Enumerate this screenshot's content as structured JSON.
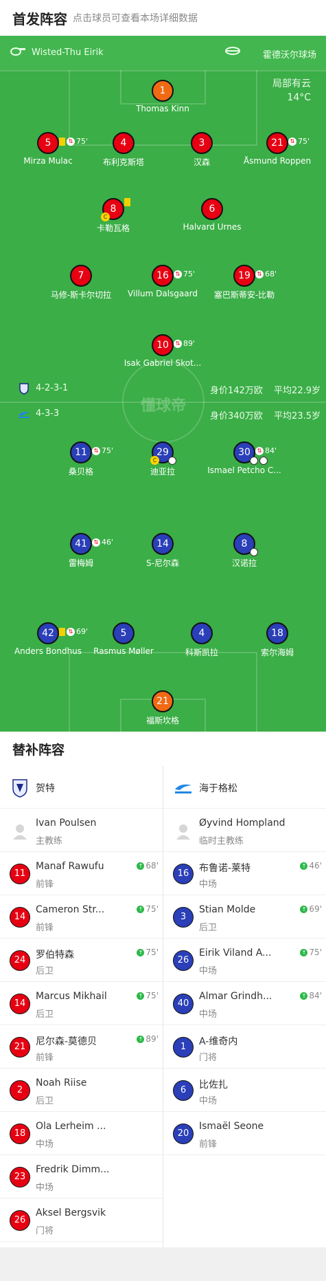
{
  "header": {
    "title": "首发阵容",
    "subtitle": "点击球员可查看本场详细数据"
  },
  "pitch": {
    "home_team": "Wisted-Thu Eirik",
    "venue": "霍德沃尔球场",
    "weather": "局部有云",
    "temperature": "14°C",
    "watermark": "懂球帝"
  },
  "home": {
    "formation": "4-2-3-1",
    "value": "身价142万欧",
    "avg_age": "平均22.9岁",
    "players": [
      {
        "num": "1",
        "name": "Thomas Kinn",
        "gk": true
      },
      {
        "num": "5",
        "name": "Mirza Mulac",
        "yellow": true,
        "sub": "75'"
      },
      {
        "num": "4",
        "name": "布利克斯塔"
      },
      {
        "num": "3",
        "name": "汉森"
      },
      {
        "num": "21",
        "name": "Åsmund Roppen",
        "sub": "75'"
      },
      {
        "num": "8",
        "name": "卡勒瓦格",
        "yellow": true,
        "captain": true
      },
      {
        "num": "6",
        "name": "Halvard Urnes"
      },
      {
        "num": "7",
        "name": "马修-斯卡尔切拉"
      },
      {
        "num": "16",
        "name": "Villum Dalsgaard",
        "sub": "75'"
      },
      {
        "num": "19",
        "name": "塞巴斯蒂安-比勒",
        "sub": "68'"
      },
      {
        "num": "10",
        "name": "Isak Gabriel Skot...",
        "sub": "89'"
      }
    ]
  },
  "away": {
    "formation": "4-3-3",
    "value": "身价340万欧",
    "avg_age": "平均23.5岁",
    "players": [
      {
        "num": "11",
        "name": "桑贝格",
        "sub": "75'"
      },
      {
        "num": "29",
        "name": "迪亚拉",
        "captain": true,
        "goal": true
      },
      {
        "num": "30",
        "name": "Ismael Petcho C...",
        "sub": "84'",
        "goals": 2
      },
      {
        "num": "41",
        "name": "雷梅姆",
        "sub": "46'"
      },
      {
        "num": "14",
        "name": "S-尼尔森"
      },
      {
        "num": "8",
        "name": "汉诺拉",
        "goal": true
      },
      {
        "num": "42",
        "name": "Anders Bondhus",
        "yellow": true,
        "sub": "69'"
      },
      {
        "num": "5",
        "name": "Rasmus Møller"
      },
      {
        "num": "4",
        "name": "科斯凯拉"
      },
      {
        "num": "18",
        "name": "索尔海姆"
      },
      {
        "num": "21",
        "name": "福斯坎格",
        "gk": true
      }
    ]
  },
  "subs": {
    "title": "替补阵容",
    "left_team": "贺特",
    "right_team": "海于格松",
    "left": [
      {
        "coach": true,
        "name": "Ivan Poulsen",
        "pos": "主教练"
      },
      {
        "num": "11",
        "name": "Manaf Rawufu",
        "pos": "前锋",
        "in": "68'"
      },
      {
        "num": "14",
        "name": "Cameron Str...",
        "pos": "前锋",
        "in": "75'"
      },
      {
        "num": "24",
        "name": "罗伯特森",
        "pos": "后卫",
        "in": "75'"
      },
      {
        "num": "14",
        "name": "Marcus Mikhail",
        "pos": "后卫",
        "in": "75'"
      },
      {
        "num": "21",
        "name": "尼尔森-莫德贝",
        "pos": "前锋",
        "in": "89'"
      },
      {
        "num": "2",
        "name": "Noah Riise",
        "pos": "后卫"
      },
      {
        "num": "18",
        "name": "Ola Lerheim ...",
        "pos": "中场"
      },
      {
        "num": "23",
        "name": "Fredrik Dimm...",
        "pos": "中场"
      },
      {
        "num": "26",
        "name": "Aksel Bergsvik",
        "pos": "门将"
      }
    ],
    "right": [
      {
        "coach": true,
        "name": "Øyvind Hompland",
        "pos": "临时主教练"
      },
      {
        "num": "16",
        "name": "布鲁诺-莱特",
        "pos": "中场",
        "in": "46'"
      },
      {
        "num": "3",
        "name": "Stian Molde",
        "pos": "后卫",
        "in": "69'"
      },
      {
        "num": "26",
        "name": "Eirik Viland A...",
        "pos": "中场",
        "in": "75'"
      },
      {
        "num": "40",
        "name": "Almar Grindh...",
        "pos": "中场",
        "in": "84'"
      },
      {
        "num": "1",
        "name": "A-维奇内",
        "pos": "门将"
      },
      {
        "num": "6",
        "name": "比佐扎",
        "pos": "中场"
      },
      {
        "num": "20",
        "name": "Ismaël Seone",
        "pos": "前锋"
      }
    ]
  }
}
